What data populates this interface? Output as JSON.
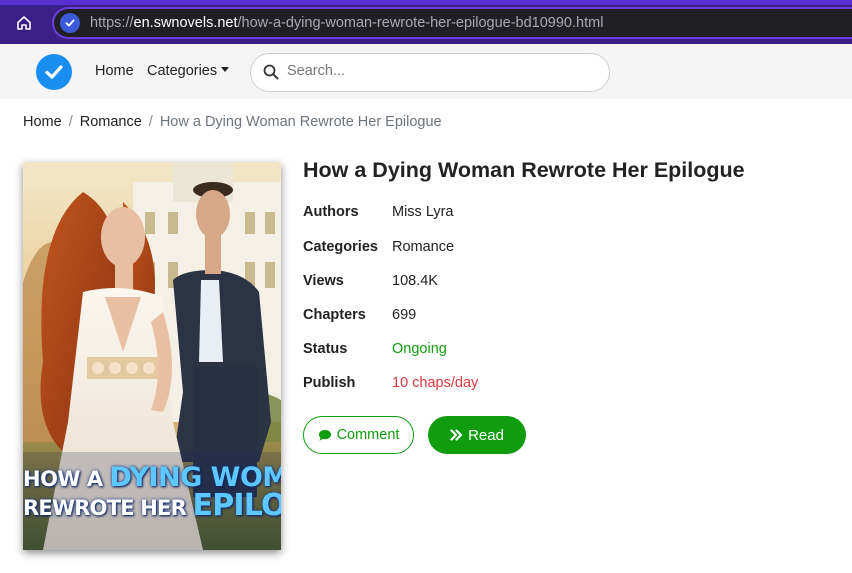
{
  "browser": {
    "url_scheme": "https://",
    "url_host": "en.swnovels.net",
    "url_path": "/how-a-dying-woman-rewrote-her-epilogue-bd10990.html"
  },
  "nav": {
    "home": "Home",
    "categories": "Categories",
    "search_placeholder": "Search..."
  },
  "breadcrumb": {
    "home": "Home",
    "category": "Romance",
    "current": "How a Dying Woman Rewrote Her Epilogue"
  },
  "cover": {
    "line1_small": "HOW A",
    "line1_big": "DYING WOMAN",
    "line2_small": "REWROTE HER",
    "line2_big": "EPILOGUE"
  },
  "book": {
    "title": "How a Dying Woman Rewrote Her Epilogue",
    "info": [
      {
        "label": "Authors",
        "value": "Miss Lyra"
      },
      {
        "label": "Categories",
        "value": "Romance"
      },
      {
        "label": "Views",
        "value": "108.4K"
      },
      {
        "label": "Chapters",
        "value": "699"
      },
      {
        "label": "Status",
        "value": "Ongoing"
      },
      {
        "label": "Publish",
        "value": "10 chaps/day"
      }
    ]
  },
  "buttons": {
    "comment": "Comment",
    "read": "Read"
  },
  "colors": {
    "browser_bar": "#3a1f86",
    "accent_green": "#0f9d0f",
    "status_red": "#d9363e",
    "logo_blue": "#1a8df0"
  }
}
